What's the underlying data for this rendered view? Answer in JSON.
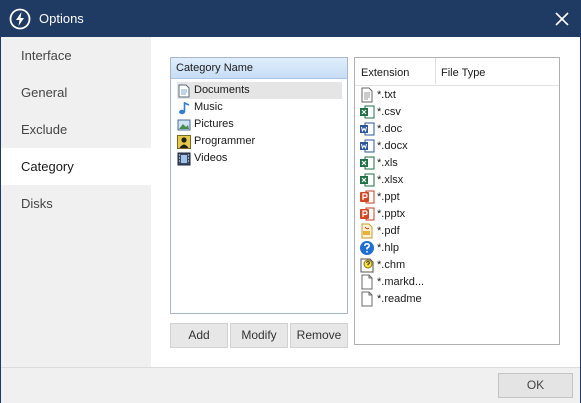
{
  "window": {
    "title": "Options",
    "accent_color": "#1f3a63",
    "icons": {
      "app": "lightning-power-icon",
      "close": "close-icon"
    }
  },
  "sidebar": {
    "items": [
      {
        "label": "Interface",
        "active": false
      },
      {
        "label": "General",
        "active": false
      },
      {
        "label": "Exclude",
        "active": false
      },
      {
        "label": "Category",
        "active": true
      },
      {
        "label": "Disks",
        "active": false
      }
    ]
  },
  "category_panel": {
    "header": "Category Name",
    "items": [
      {
        "label": "Documents",
        "icon": "document-icon",
        "selected": true
      },
      {
        "label": "Music",
        "icon": "music-note-icon",
        "selected": false
      },
      {
        "label": "Pictures",
        "icon": "picture-icon",
        "selected": false
      },
      {
        "label": "Programmer",
        "icon": "programmer-icon",
        "selected": false
      },
      {
        "label": "Videos",
        "icon": "video-film-icon",
        "selected": false
      }
    ],
    "buttons": {
      "add": "Add",
      "modify": "Modify",
      "remove": "Remove"
    }
  },
  "extension_panel": {
    "columns": {
      "extension": "Extension",
      "file_type": "File Type"
    },
    "rows": [
      {
        "ext": "*.txt",
        "icon": "text-file-icon"
      },
      {
        "ext": "*.csv",
        "icon": "excel-file-icon"
      },
      {
        "ext": "*.doc",
        "icon": "word-file-icon"
      },
      {
        "ext": "*.docx",
        "icon": "word-file-icon"
      },
      {
        "ext": "*.xls",
        "icon": "excel-file-icon"
      },
      {
        "ext": "*.xlsx",
        "icon": "excel-file-icon"
      },
      {
        "ext": "*.ppt",
        "icon": "powerpoint-file-icon"
      },
      {
        "ext": "*.pptx",
        "icon": "powerpoint-file-icon"
      },
      {
        "ext": "*.pdf",
        "icon": "pdf-file-icon"
      },
      {
        "ext": "*.hlp",
        "icon": "help-file-icon"
      },
      {
        "ext": "*.chm",
        "icon": "chm-help-file-icon"
      },
      {
        "ext": "*.markd...",
        "icon": "blank-file-icon"
      },
      {
        "ext": "*.readme",
        "icon": "blank-file-icon"
      }
    ]
  },
  "footer": {
    "ok_label": "OK"
  }
}
